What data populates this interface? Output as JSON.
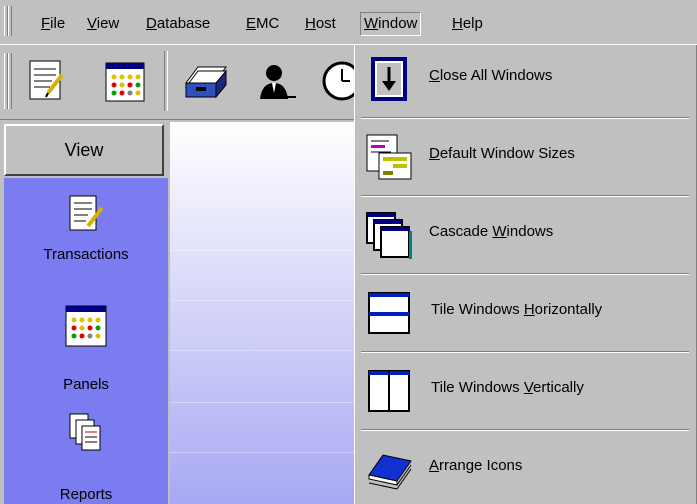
{
  "menubar": {
    "items": [
      {
        "pre": "",
        "key": "F",
        "post": "ile"
      },
      {
        "pre": "",
        "key": "V",
        "post": "iew"
      },
      {
        "pre": "",
        "key": "D",
        "post": "atabase"
      },
      {
        "pre": "",
        "key": "E",
        "post": "MC"
      },
      {
        "pre": "",
        "key": "H",
        "post": "ost"
      },
      {
        "pre": "",
        "key": "W",
        "post": "indow"
      },
      {
        "pre": "",
        "key": "H",
        "post": "elp"
      }
    ]
  },
  "toolbar": {
    "buttons": [
      "transactions-icon",
      "panels-icon",
      "cardfile-icon",
      "user-icon",
      "clock-icon"
    ]
  },
  "left_panel": {
    "view_label": "View",
    "items": [
      {
        "label": "Transactions",
        "icon": "transactions-icon"
      },
      {
        "label": "Panels",
        "icon": "panels-icon"
      },
      {
        "label": "Reports",
        "icon": "reports-icon"
      }
    ]
  },
  "window_menu": {
    "items": [
      {
        "pre": "",
        "key": "C",
        "post": "lose All Windows",
        "icon": "close-all-windows-icon"
      },
      {
        "pre": "",
        "key": "D",
        "post": "efault Window Sizes",
        "icon": "default-window-sizes-icon"
      },
      {
        "pre": "Cascade ",
        "key": "W",
        "post": "indows",
        "icon": "cascade-windows-icon"
      },
      {
        "pre": "Tile Windows ",
        "key": "H",
        "post": "orizontally",
        "icon": "tile-horizontal-icon"
      },
      {
        "pre": "Tile Windows ",
        "key": "V",
        "post": "ertically",
        "icon": "tile-vertical-icon"
      },
      {
        "pre": "",
        "key": "A",
        "post": "rrange Icons",
        "icon": "arrange-icons-icon"
      }
    ]
  }
}
